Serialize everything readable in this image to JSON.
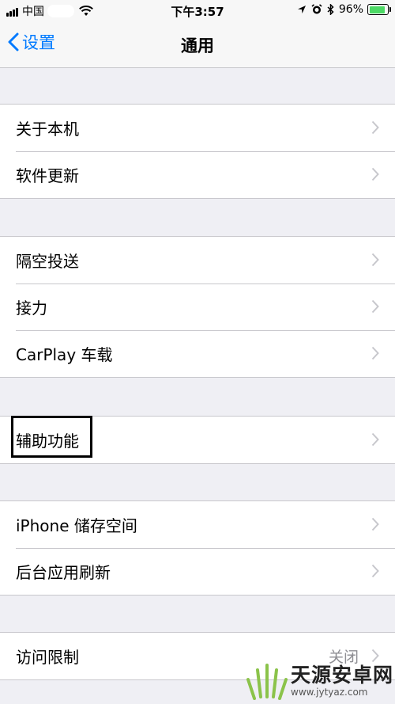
{
  "status_bar": {
    "carrier": "中国",
    "time": "下午3:57",
    "battery_text": "96%",
    "battery_level": 0.96,
    "battery_color": "#4cd964"
  },
  "nav": {
    "back_label": "设置",
    "title": "通用",
    "accent": "#007aff"
  },
  "groups": [
    {
      "items": [
        {
          "label": "关于本机"
        },
        {
          "label": "软件更新"
        }
      ]
    },
    {
      "items": [
        {
          "label": "隔空投送"
        },
        {
          "label": "接力"
        },
        {
          "label": "CarPlay 车载"
        }
      ]
    },
    {
      "items": [
        {
          "label": "辅助功能",
          "highlighted": true
        }
      ]
    },
    {
      "items": [
        {
          "label": "iPhone 储存空间"
        },
        {
          "label": "后台应用刷新"
        }
      ]
    },
    {
      "items": [
        {
          "label": "访问限制",
          "value": "关闭"
        }
      ]
    }
  ],
  "watermark": {
    "main": "天源安卓网",
    "sub": "www.jytyaz.com"
  },
  "icons": {
    "back": "chevron-left-icon",
    "disclosure": "chevron-right-icon",
    "wifi": "wifi-icon",
    "location": "location-arrow-icon",
    "alarm": "alarm-clock-icon",
    "bluetooth": "bluetooth-icon",
    "battery": "battery-icon"
  }
}
